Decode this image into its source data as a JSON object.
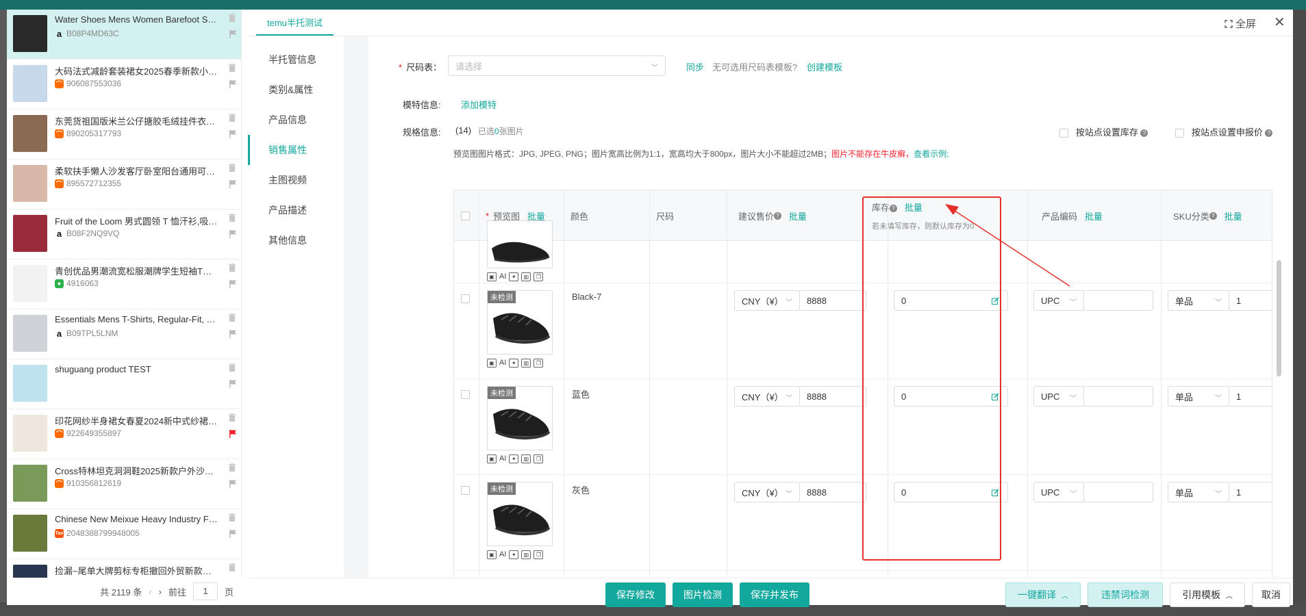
{
  "products": [
    {
      "title": "Water Shoes Mens Women Barefoot S…",
      "id": "B08P4MD63C",
      "source": "amazon",
      "active": true,
      "flag": "gray"
    },
    {
      "title": "大码法式减龄套装裙女2025春季新款小…",
      "id": "906087553036",
      "source": "alibaba",
      "active": false,
      "flag": "gray"
    },
    {
      "title": "东莞货祖国版米兰公仔搪胶毛绒挂件衣…",
      "id": "890205317793",
      "source": "alibaba",
      "active": false,
      "flag": "gray"
    },
    {
      "title": "柔软扶手懒人沙发客厅卧室阳台通用可…",
      "id": "895572712355",
      "source": "alibaba",
      "active": false,
      "flag": "gray"
    },
    {
      "title": "Fruit of the Loom 男式圆领 T 恤汗衫,吸…",
      "id": "B08F2NQ9VQ",
      "source": "amazon",
      "active": false,
      "flag": "gray"
    },
    {
      "title": "青创优品男潮流宽松服潮牌学生短袖T恤…",
      "id": "4916063",
      "source": "pdd",
      "active": false,
      "flag": "gray"
    },
    {
      "title": "Essentials Mens T-Shirts, Regular-Fit, …",
      "id": "B09TPL5LNM",
      "source": "amazon",
      "active": false,
      "flag": "gray"
    },
    {
      "title": "shuguang product TEST",
      "id": "",
      "source": "",
      "active": false,
      "flag": "gray"
    },
    {
      "title": "印花网纱半身裙女春夏2024新中式纱裙…",
      "id": "922649355897",
      "source": "alibaba",
      "active": false,
      "flag": "red"
    },
    {
      "title": "Cross特林坦克洞洞鞋2025新款户外沙…",
      "id": "910356812619",
      "source": "alibaba",
      "active": false,
      "flag": "gray"
    },
    {
      "title": "Chinese New Meixue Heavy Industry F…",
      "id": "2048388799948005",
      "source": "taobao",
      "active": false,
      "flag": "gray"
    },
    {
      "title": "捡漏~尾单大牌剪标专柜撤回外贸新款韩…",
      "id": "",
      "source": "",
      "active": false,
      "flag": "gray"
    }
  ],
  "pager": {
    "total": "共 2119 条",
    "goto": "前往",
    "page": "1",
    "unit": "页"
  },
  "header": {
    "tab": "temu半托测试",
    "fullscreen": "全屏"
  },
  "nav": [
    "半托管信息",
    "类别&属性",
    "产品信息",
    "销售属性",
    "主图视频",
    "产品描述",
    "其他信息"
  ],
  "nav_active": 3,
  "size_chart": {
    "label": "尺码表：",
    "placeholder": "请选择",
    "sync": "同步",
    "no_template": "无可选用尺码表模板?",
    "create": "创建模板"
  },
  "model": {
    "label": "模特信息:",
    "add": "添加模特"
  },
  "spec": {
    "label": "规格信息:",
    "count": "(14)",
    "selected_prefix": "已选",
    "selected_num": "0",
    "selected_suffix": "张图片",
    "site_stock": "按站点设置库存",
    "site_price": "按站点设置申报价",
    "hint": "预览图图片格式：JPG, JPEG, PNG；图片宽高比例为1:1，宽高均大于800px，图片大小不能超过2MB；",
    "warn": "图片不能存在牛皮癣，",
    "example": "查看示例;"
  },
  "table": {
    "preview": "预览图",
    "batch": "批量",
    "color": "颜色",
    "size": "尺码",
    "price": "建议售价",
    "stock": "库存",
    "stock_hint": "若未填写库存，则默认库存为0",
    "code": "产品编码",
    "sku": "SKU分类"
  },
  "rows": [
    {
      "badge": "未检测",
      "color": "Black-7",
      "currency": "CNY（¥）",
      "price": "8888",
      "stock": "0",
      "code_type": "UPC",
      "sku_type": "单品",
      "sku_qty": "1"
    },
    {
      "badge": "未检测",
      "color": "蓝色",
      "currency": "CNY（¥）",
      "price": "8888",
      "stock": "0",
      "code_type": "UPC",
      "sku_type": "单品",
      "sku_qty": "1"
    },
    {
      "badge": "未检测",
      "color": "灰色",
      "currency": "CNY（¥）",
      "price": "8888",
      "stock": "0",
      "code_type": "UPC",
      "sku_type": "单品",
      "sku_qty": "1"
    }
  ],
  "footer": {
    "save": "保存修改",
    "check_img": "图片检测",
    "save_publish": "保存并发布",
    "translate": "一键翻译",
    "banned_check": "违禁词检测",
    "template": "引用模板",
    "cancel": "取消"
  },
  "colors": {
    "accent": "#13a89e",
    "highlight": "#e8302a",
    "warn": "#f5222d"
  }
}
